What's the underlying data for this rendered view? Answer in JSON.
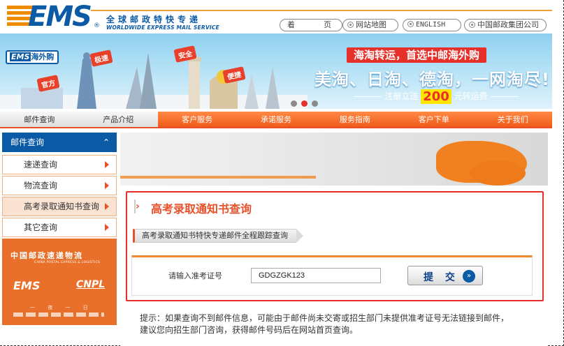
{
  "header": {
    "logo_text": "EMS",
    "logo_reg": "®",
    "slogan_cn": "全球邮政特快专递",
    "slogan_en": "WORLDWIDE EXPRESS MAIL SERVICE",
    "nav_home_a": "着",
    "nav_home_b": "页",
    "nav_sitemap": "网站地图",
    "nav_english": "ENGLISH",
    "nav_group": "中国邮政集团公司"
  },
  "banner": {
    "badge_ems": "EMS",
    "badge_text": "海外购",
    "tag_official": "官方",
    "tag_fast": "极速",
    "tag_safe": "安全",
    "tag_convenient": "便捷",
    "headline": "海淘转运，首选中邮海外购",
    "main": "美淘、日淘、德淘，一网淘尽!",
    "sub_pre": "注册立送",
    "sub_num": "200",
    "sub_post": "元转运费",
    "slides": 3,
    "active_slide": 2
  },
  "mainnav": {
    "items": [
      "邮件查询",
      "产品介绍",
      "客户服务",
      "承诺服务",
      "服务指南",
      "客户下单",
      "关于我们"
    ]
  },
  "sidebar": {
    "header": "邮件查询",
    "items": [
      "速递查询",
      "物流查询",
      "高考录取通知书查询",
      "其它查询"
    ],
    "promo_cn": "中国邮政速递物流",
    "promo_en": "CHINA POSTAL EXPRESS & LOGISTICS",
    "promo_ems": "EMS",
    "promo_cnpl": "CNPL",
    "promo_foot": "一 夜 一 日"
  },
  "content": {
    "title": "高考录取通知书查询",
    "subtitle": "高考录取通知书特快专递邮件全程跟踪查询",
    "input_label": "请输入准考证号",
    "input_value": "GDGZGK123",
    "submit_label": "提 交",
    "note_line1": "提示：如果查询不到邮件信息，可能由于邮件尚未交寄或招生部门未提供准考证号无法链接到邮件，",
    "note_line2": "建议您向招生部门咨询，获得邮件号码后在网站首页查询。"
  },
  "colors": {
    "brand_blue": "#0b5aa6",
    "accent_orange": "#e8502a",
    "alert_red": "#e8302a"
  }
}
